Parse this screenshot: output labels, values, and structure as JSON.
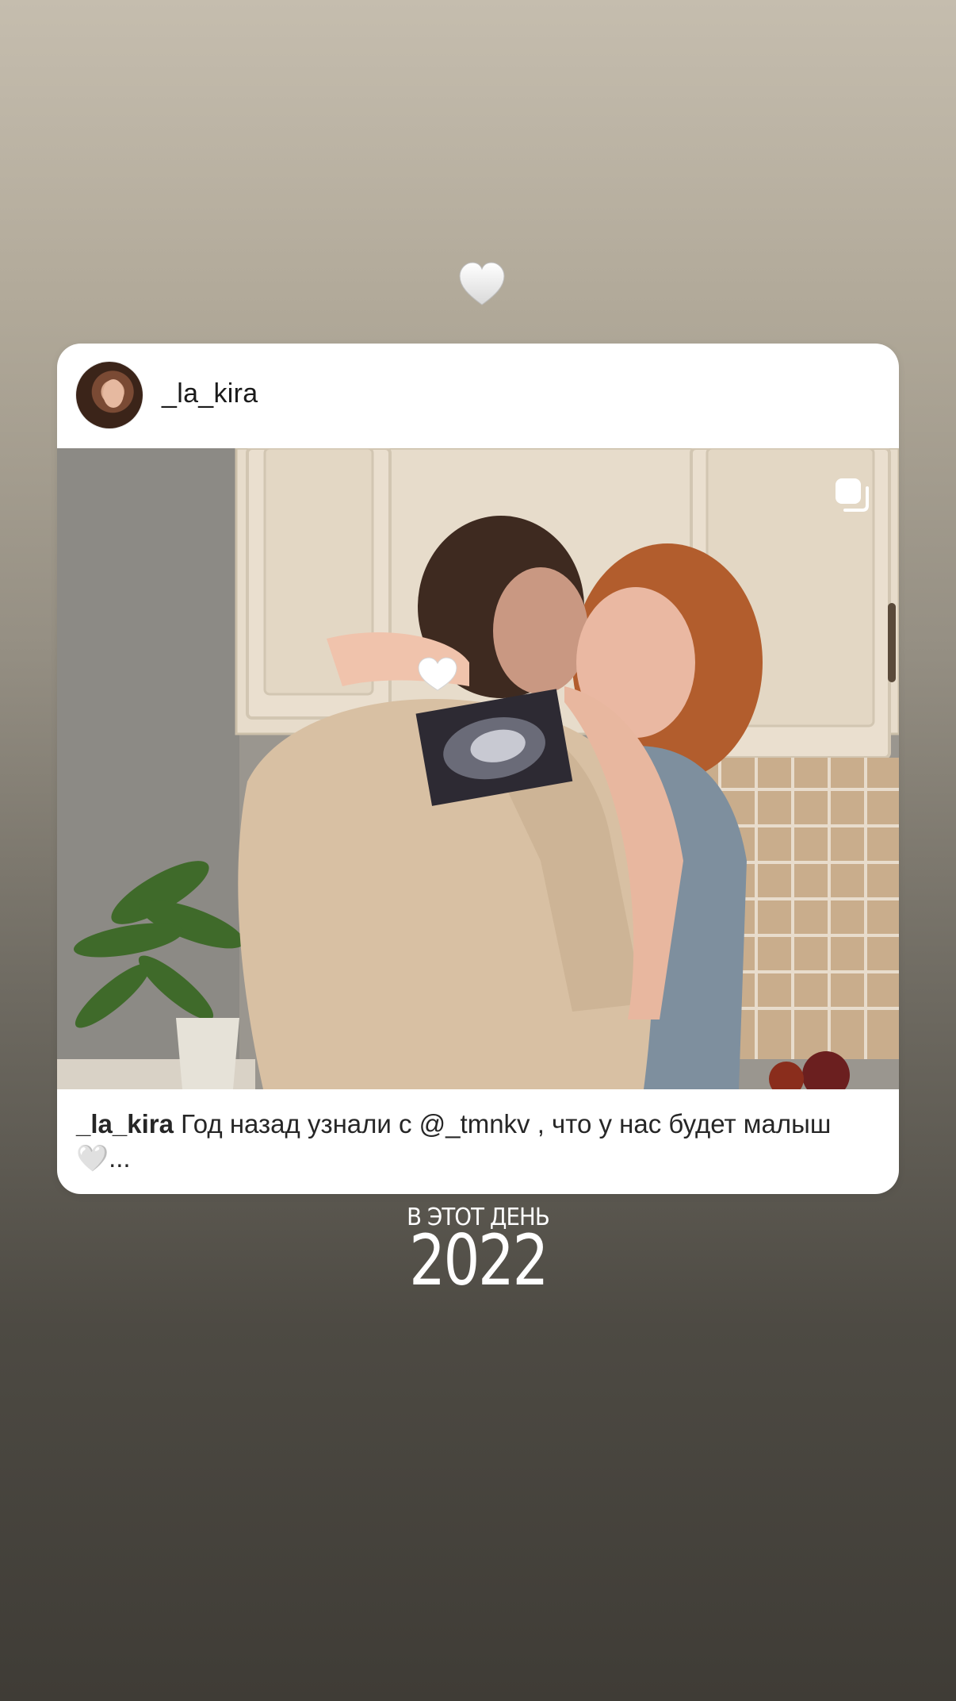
{
  "story": {
    "sticker_icon": "white-heart-icon",
    "on_this_day_label": "В ЭТОТ ДЕНЬ",
    "year": "2022"
  },
  "post": {
    "username": "_la_kira",
    "multi_photo_icon": "carousel-icon",
    "caption_user": "_la_kira",
    "caption_text": " Год назад узнали с @_tmnkv , что у нас будет малыш 🤍..."
  },
  "colors": {
    "card_background": "#ffffff",
    "story_gradient_top": "#c5bdae",
    "story_gradient_bottom": "#3f3c36",
    "text_primary": "#262626"
  }
}
